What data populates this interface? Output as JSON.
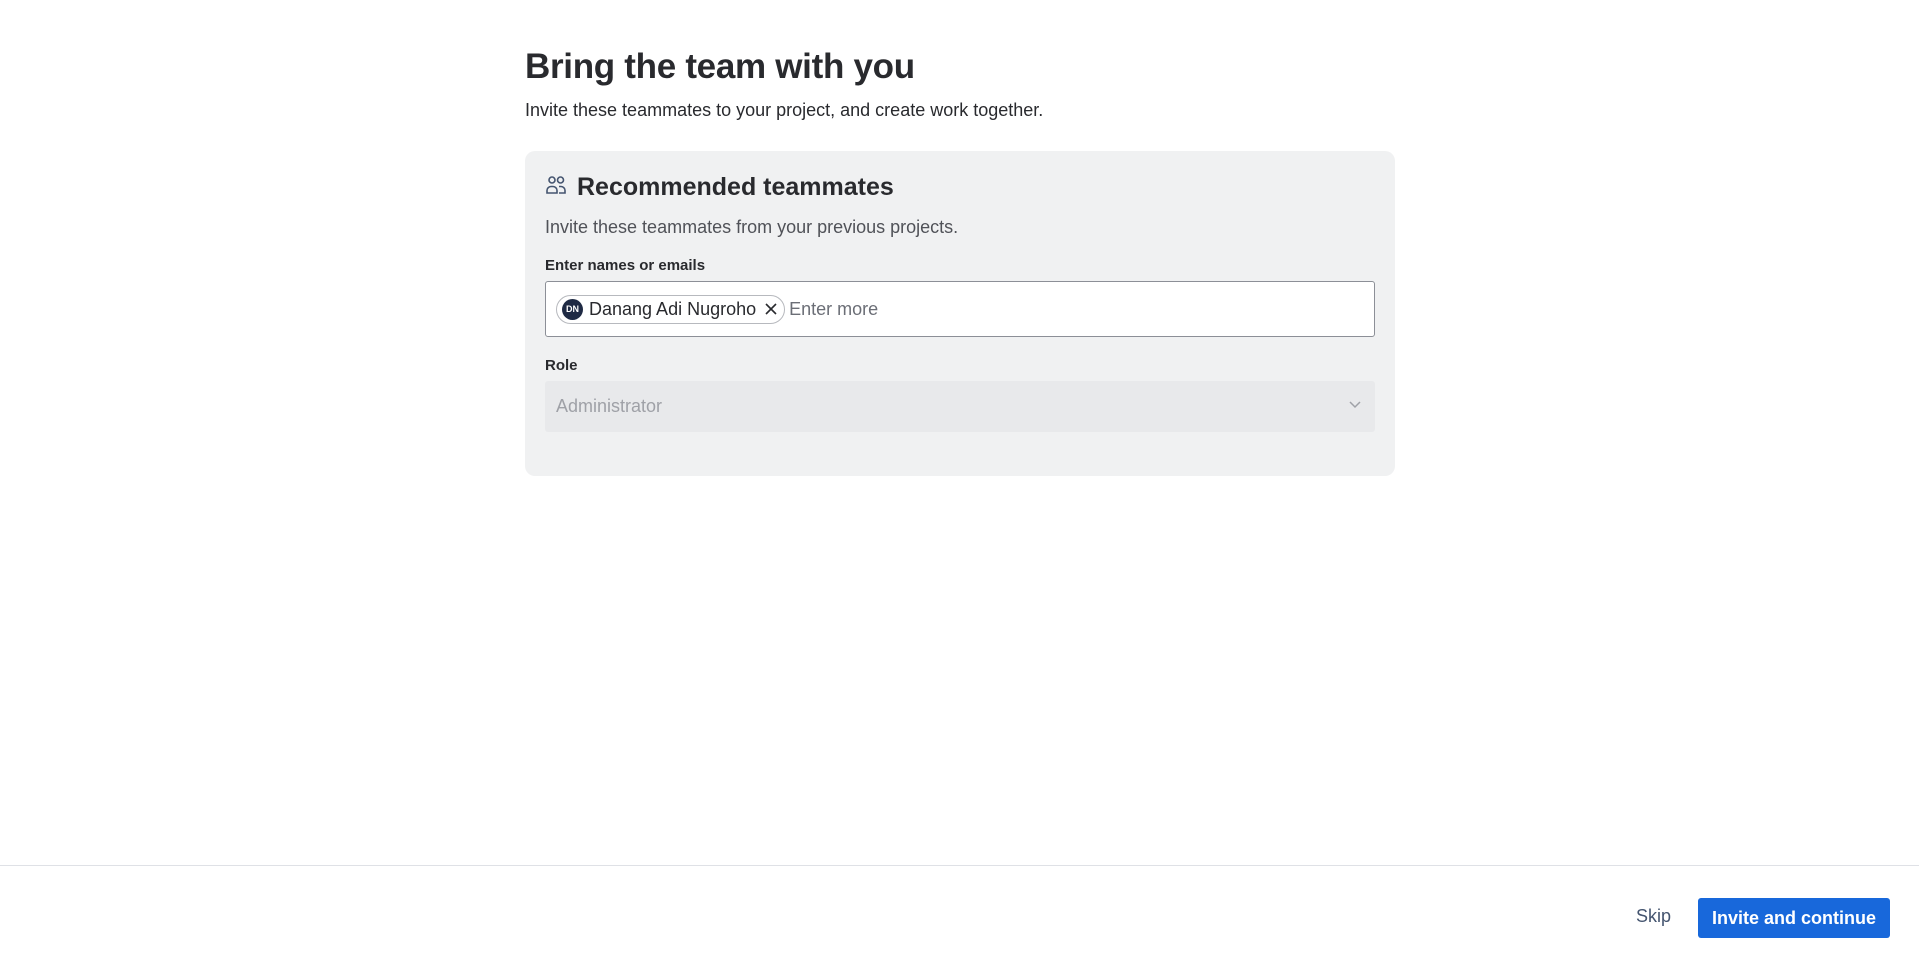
{
  "header": {
    "title": "Bring the team with you",
    "subtitle": "Invite these teammates to your project, and create work together."
  },
  "card": {
    "icon": "people-icon",
    "title": "Recommended teammates",
    "description": "Invite these teammates from your previous projects.",
    "names_field": {
      "label": "Enter names or emails",
      "placeholder": "Enter more",
      "value": "",
      "chips": [
        {
          "initials": "DN",
          "name": "Danang Adi Nugroho"
        }
      ]
    },
    "role_field": {
      "label": "Role",
      "selected": "Administrator"
    }
  },
  "footer": {
    "skip_label": "Skip",
    "primary_label": "Invite and continue"
  },
  "colors": {
    "primary": "#1868db",
    "card_bg": "#f0f1f2",
    "avatar_bg": "#1f2a44"
  }
}
